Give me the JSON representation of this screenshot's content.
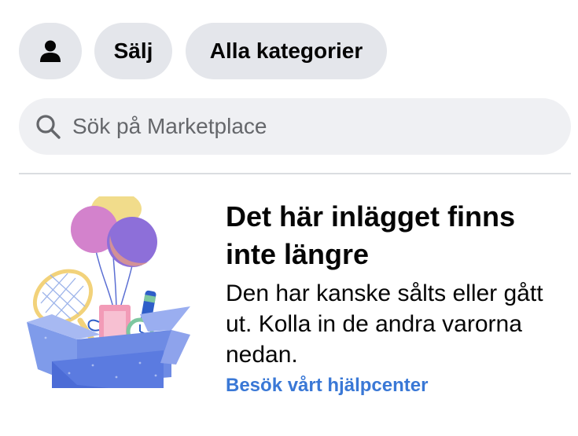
{
  "topbar": {
    "profile_icon": "person-icon",
    "sell_label": "Sälj",
    "categories_label": "Alla kategorier"
  },
  "search": {
    "icon": "search-icon",
    "placeholder": "Sök på Marketplace"
  },
  "notice": {
    "illustration": "gift-box-illustration",
    "title": "Det här inlägget finns inte längre",
    "body": "Den har kanske sålts eller gått ut. Kolla in de andra varorna nedan.",
    "help_link": "Besök vårt hjälpcenter"
  },
  "colors": {
    "pill_bg": "#e4e6eb",
    "search_bg": "#eff0f3",
    "link": "#3a78d6"
  }
}
